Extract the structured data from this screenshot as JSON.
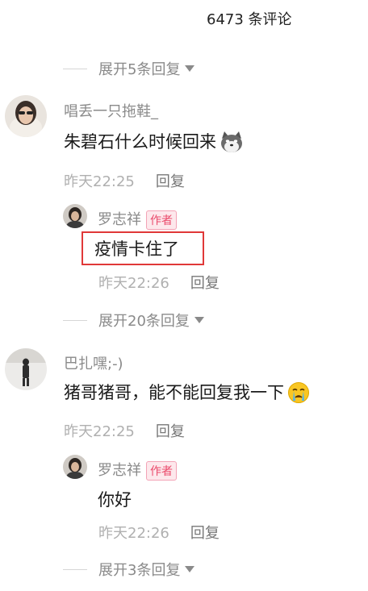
{
  "header": {
    "comment_count": "6473 条评论"
  },
  "expand_labels": {
    "first": "展开5条回复",
    "second": "展开20条回复",
    "third": "展开3条回复"
  },
  "threads": [
    {
      "user": "唱丢一只拖鞋_",
      "text": "朱碧石什么时候回来",
      "emoji": "dog-emoji",
      "time": "昨天22:25",
      "reply_label": "回复",
      "reply": {
        "user": "罗志祥",
        "badge": "作者",
        "text": "疫情卡住了",
        "time": "昨天22:26",
        "reply_label": "回复"
      }
    },
    {
      "user": "巴扎嘿;-)",
      "text": "猪哥猪哥，能不能回复我一下",
      "emoji": "crying-emoji",
      "time": "昨天22:25",
      "reply_label": "回复",
      "reply": {
        "user": "罗志祥",
        "badge": "作者",
        "text": "你好",
        "time": "昨天22:26",
        "reply_label": "回复"
      }
    }
  ],
  "colors": {
    "badge_bg": "#fde8ec",
    "badge_text": "#ea4a6b",
    "highlight_border": "#e03838"
  }
}
